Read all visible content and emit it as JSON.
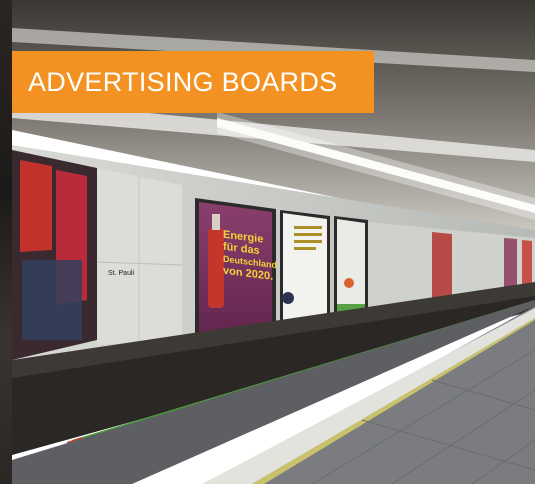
{
  "banner": {
    "title": "ADVERTISING BOARDS"
  },
  "station_sign": {
    "text": "St. Pauli"
  },
  "posters": [
    {
      "lines": [
        "Energie",
        "für das",
        "Deutschland",
        "von 2020."
      ]
    },
    {
      "lines": []
    },
    {
      "lines": []
    }
  ],
  "colors": {
    "banner": "#f39222",
    "banner_text": "#ffffff",
    "safety_line": "#4aa03a"
  }
}
